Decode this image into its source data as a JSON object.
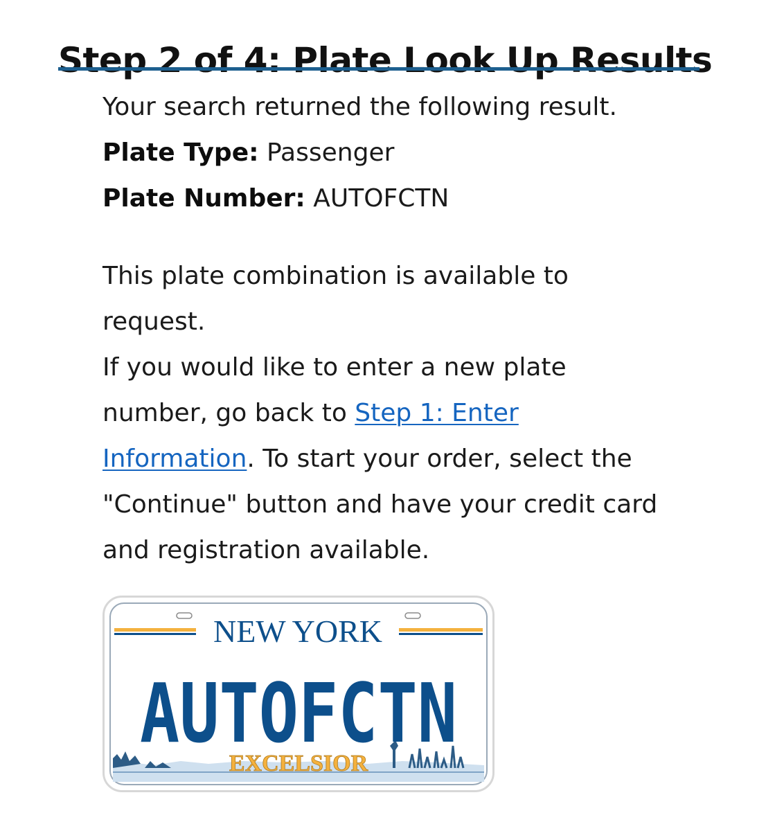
{
  "header": {
    "title": "Step 2 of 4: Plate Look Up Results"
  },
  "result": {
    "intro": "Your search returned the following result.",
    "plate_type_label": "Plate Type:",
    "plate_type_value": "Passenger",
    "plate_number_label": "Plate Number:",
    "plate_number_value": "AUTOFCTN"
  },
  "message": {
    "availability": "This plate combination is available to request.",
    "instructions_before_link": "If you would like to enter a new plate number, go back to ",
    "link_text": "Step 1: Enter Information",
    "instructions_after_link": ". To start your order, select the \"Continue\" button and have your credit card and registration available."
  },
  "plate_image": {
    "state": "NEW YORK",
    "number": "AUTOFCTN",
    "motto": "EXCELSIOR"
  },
  "colors": {
    "title_rule": "#1d5f8f",
    "link": "#1565c0",
    "plate_blue": "#0d4f8b",
    "plate_gold": "#f4b13e"
  }
}
